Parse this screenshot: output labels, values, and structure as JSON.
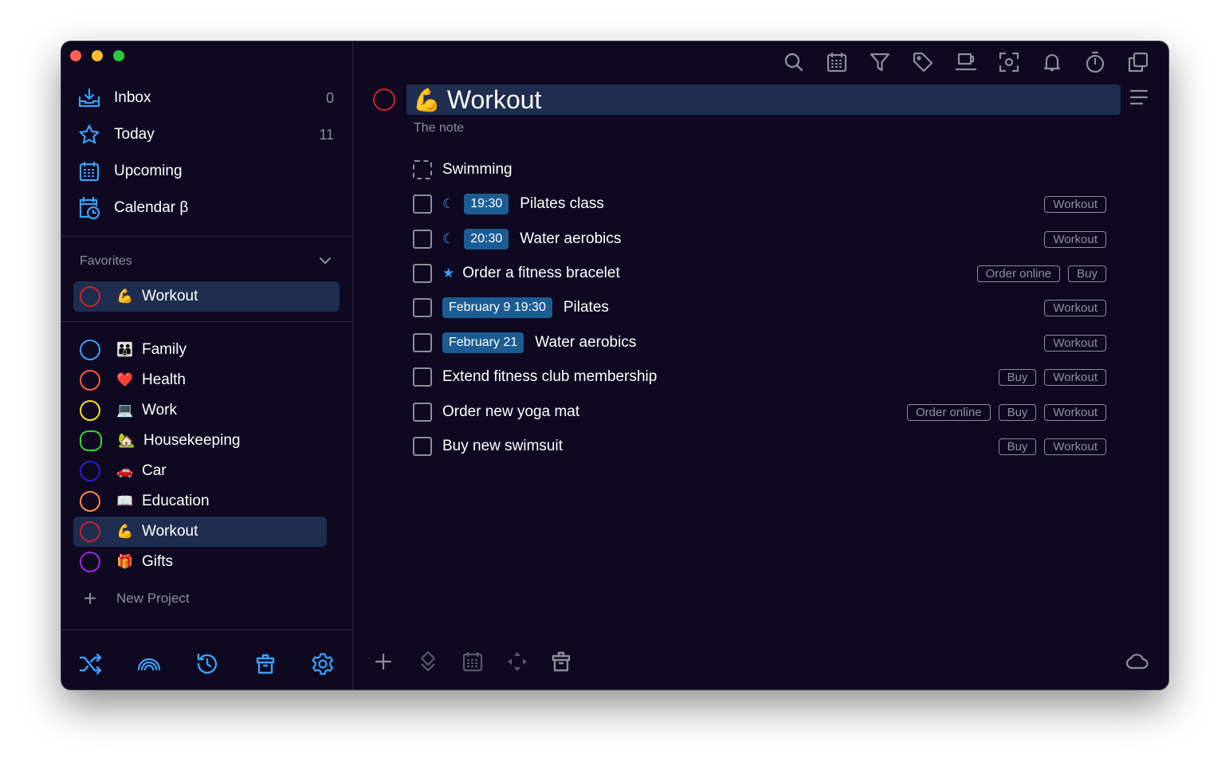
{
  "colors": {
    "window_bg": "#0e0920",
    "selection": "#1f2d50",
    "accent_blue": "#3aa0ff",
    "time_badge": "#1b5d93",
    "muted_text": "#8f8c9c",
    "workout_red": "#d0202a"
  },
  "sidebar": {
    "nav": [
      {
        "label": "Inbox",
        "count": "0",
        "icon": "inbox-icon"
      },
      {
        "label": "Today",
        "count": "11",
        "icon": "star-icon"
      },
      {
        "label": "Upcoming",
        "count": "",
        "icon": "calendar-grid-icon"
      },
      {
        "label": "Calendar β",
        "count": "",
        "icon": "calendar-clock-icon"
      }
    ],
    "favorites_label": "Favorites",
    "favorites": [
      {
        "label": "Workout",
        "emoji": "💪",
        "ring_color": "#d0202a"
      }
    ],
    "projects": [
      {
        "label": "Family",
        "emoji": "👪",
        "ring_color": "#3aa0ff"
      },
      {
        "label": "Health",
        "emoji": "❤️",
        "ring_color": "#ff5a36"
      },
      {
        "label": "Work",
        "emoji": "💻",
        "ring_color": "#ffe11a"
      },
      {
        "label": "Housekeeping",
        "emoji": "🏡",
        "ring_color": "#39d43a"
      },
      {
        "label": "Car",
        "emoji": "🚗",
        "ring_color": "#2a1fd8"
      },
      {
        "label": "Education",
        "emoji": "📖",
        "ring_color": "#ff8a3d"
      },
      {
        "label": "Workout",
        "emoji": "💪",
        "ring_color": "#d0202a"
      },
      {
        "label": "Gifts",
        "emoji": "🎁",
        "ring_color": "#a326e0"
      }
    ],
    "new_project_label": "New Project",
    "bottom_icons": [
      "shuffle-icon",
      "rainbow-icon",
      "history-icon",
      "trash-icon",
      "settings-icon"
    ]
  },
  "main": {
    "toolbar_icons": [
      "search-icon",
      "calendar-icon",
      "filter-icon",
      "tag-icon",
      "coffee-cup-icon",
      "focus-icon",
      "bell-icon",
      "timer-icon",
      "duplicate-icon"
    ],
    "title_emoji": "💪",
    "title": "Workout",
    "note": "The note",
    "tasks": [
      {
        "label": "Swimming",
        "time": "",
        "marker": "",
        "tags": [],
        "heading": true
      },
      {
        "label": "Pilates class",
        "time": "19:30",
        "marker": "moon",
        "tags": [
          "Workout"
        ]
      },
      {
        "label": "Water aerobics",
        "time": "20:30",
        "marker": "moon",
        "tags": [
          "Workout"
        ]
      },
      {
        "label": "Order a fitness bracelet",
        "time": "",
        "marker": "star",
        "tags": [
          "Order online",
          "Buy"
        ]
      },
      {
        "label": "Pilates",
        "time": "February 9 19:30",
        "marker": "",
        "tags": [
          "Workout"
        ]
      },
      {
        "label": "Water aerobics",
        "time": "February 21",
        "marker": "",
        "tags": [
          "Workout"
        ]
      },
      {
        "label": "Extend fitness club membership",
        "time": "",
        "marker": "",
        "tags": [
          "Buy",
          "Workout"
        ]
      },
      {
        "label": "Order new yoga mat",
        "time": "",
        "marker": "",
        "tags": [
          "Order online",
          "Buy",
          "Workout"
        ]
      },
      {
        "label": "Buy new swimsuit",
        "time": "",
        "marker": "",
        "tags": [
          "Buy",
          "Workout"
        ]
      }
    ],
    "bottom_icons": [
      "add-icon",
      "move-icon",
      "calendar-icon",
      "arrows-icon",
      "trash-icon",
      "cloud-icon"
    ]
  }
}
